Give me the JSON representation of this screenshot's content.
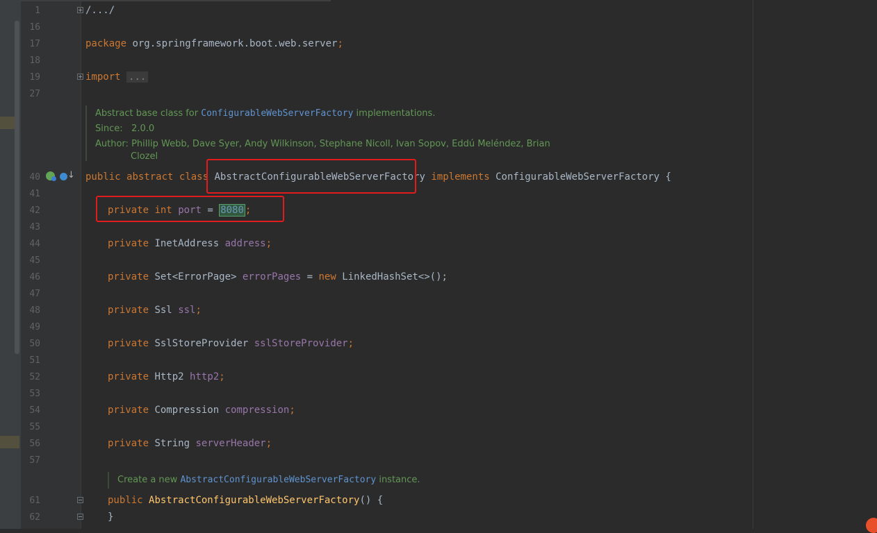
{
  "lines": [
    {
      "num": "1",
      "fold": "plus"
    },
    {
      "num": "16"
    },
    {
      "num": "17"
    },
    {
      "num": "18"
    },
    {
      "num": "19",
      "fold": "plus"
    },
    {
      "num": "27"
    },
    {
      "num": "40"
    },
    {
      "num": "41"
    },
    {
      "num": "42"
    },
    {
      "num": "43"
    },
    {
      "num": "44"
    },
    {
      "num": "45"
    },
    {
      "num": "46"
    },
    {
      "num": "47"
    },
    {
      "num": "48"
    },
    {
      "num": "49"
    },
    {
      "num": "50"
    },
    {
      "num": "51"
    },
    {
      "num": "52"
    },
    {
      "num": "53"
    },
    {
      "num": "54"
    },
    {
      "num": "55"
    },
    {
      "num": "56"
    },
    {
      "num": "57"
    },
    {
      "num": "61",
      "fold": "minus"
    },
    {
      "num": "62",
      "fold": "minus"
    }
  ],
  "code": {
    "header_fold": "/.../",
    "package_kw": "package",
    "package_name": " org.springframework.boot.web.server",
    "semicolon": ";",
    "import_kw": "import",
    "import_fold": "...",
    "class_mod1": "public",
    "class_mod2": "abstract",
    "class_kw": "class",
    "class_name": "AbstractConfigurableWebServerFactory",
    "implements_kw": "implements",
    "interface_name": "ConfigurableWebServerFactory",
    "open_brace": "{",
    "private_kw": "private",
    "int_kw": "int",
    "port_field": "port",
    "equals": " = ",
    "port_value": "8080",
    "inet_type": "InetAddress",
    "address_field": "address",
    "set_type": "Set<ErrorPage>",
    "errorpages_field": "errorPages",
    "new_kw": "new",
    "linkedhashset": "LinkedHashSet<>();",
    "ssl_type": "Ssl",
    "ssl_field": "ssl",
    "sslstore_type": "SslStoreProvider",
    "sslstore_field": "sslStoreProvider",
    "http2_type": "Http2",
    "http2_field": "http2",
    "compression_type": "Compression",
    "compression_field": "compression",
    "string_type": "String",
    "serverheader_field": "serverHeader",
    "ctor_public": "public",
    "ctor_name": "AbstractConfigurableWebServerFactory",
    "ctor_tail": "() {",
    "close_brace": "}"
  },
  "doc1": {
    "prefix": "Abstract base class for ",
    "link": "ConfigurableWebServerFactory",
    "suffix": " implementations.",
    "since_label": "Since:",
    "since_value": "2.0.0",
    "author_label": "Author:",
    "author_line1": "Phillip Webb, Dave Syer, Andy Wilkinson, Stephane Nicoll, Ivan Sopov, Eddú Meléndez, Brian",
    "author_line2": "Clozel"
  },
  "doc2": {
    "prefix": "Create a new ",
    "link": "AbstractConfigurableWebServerFactory",
    "suffix": " instance."
  },
  "icons": {
    "gutter1": "spring-bean-icon",
    "gutter2": "implementation-icon"
  },
  "colors": {
    "background": "#2b2b2b",
    "keyword": "#cc7832",
    "field": "#9876aa",
    "number": "#6897bb",
    "doc": "#629755",
    "highlight_box": "#e21c1c"
  }
}
